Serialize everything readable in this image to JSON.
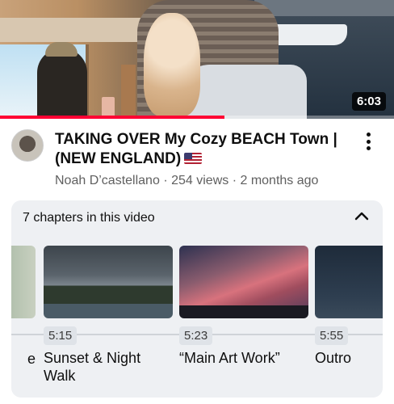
{
  "video": {
    "duration": "6:03",
    "progress_fraction": 0.57,
    "title": "TAKING OVER My Cozy BEACH Town | (NEW ENGLAND)",
    "channel": "Noah D’castellano",
    "views": "254 views",
    "age": "2 months ago",
    "flag_icon": "us-flag-icon",
    "more_icon": "vertical-dots-icon"
  },
  "chapters": {
    "heading": "7 chapters in this video",
    "collapse_icon": "chevron-up-icon",
    "items": [
      {
        "time": "",
        "label": "e"
      },
      {
        "time": "5:15",
        "label": "Sunset & Night Walk"
      },
      {
        "time": "5:23",
        "label": "“Main Art Work”"
      },
      {
        "time": "5:55",
        "label": "Outro"
      }
    ]
  },
  "colors": {
    "progress": "#ff0033",
    "panel_bg": "#eef0f3"
  }
}
